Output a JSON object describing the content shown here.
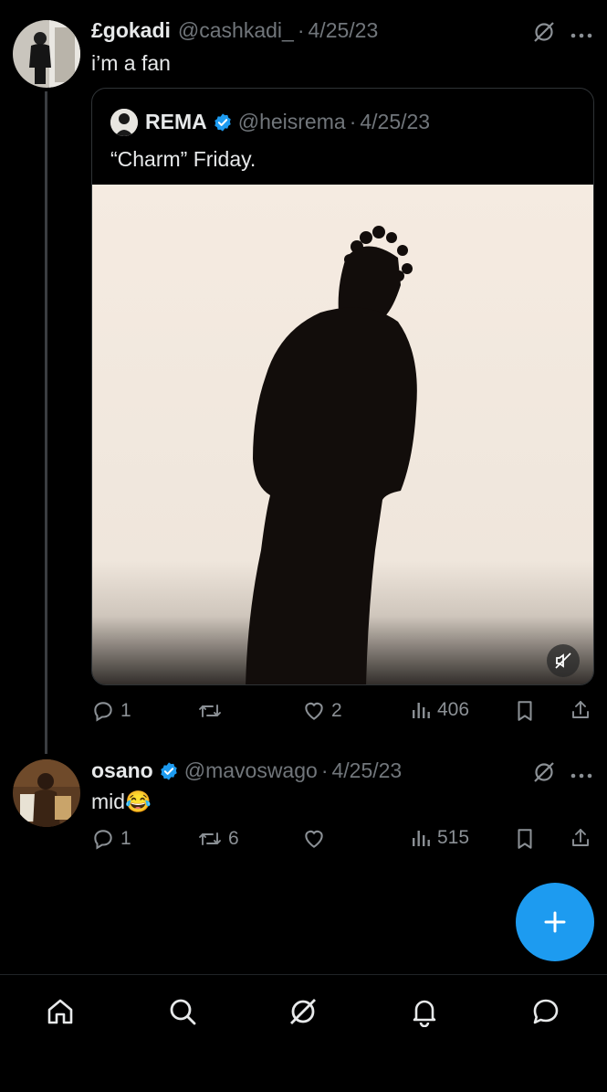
{
  "tweets": [
    {
      "name": "£gokadi",
      "handle": "@cashkadi_",
      "separator": "·",
      "date": "4/25/23",
      "text": "i’m a fan",
      "quote": {
        "name": "REMA",
        "handle": "@heisrema",
        "separator": "·",
        "date": "4/25/23",
        "text": "“Charm” Friday."
      },
      "actions": {
        "replies": "1",
        "retweets": "",
        "likes": "2",
        "views": "406"
      }
    },
    {
      "name": "osano",
      "handle": "@mavoswago",
      "separator": "·",
      "date": "4/25/23",
      "text": "mid",
      "emoji": "😂",
      "actions": {
        "replies": "1",
        "retweets": "6",
        "likes": "",
        "views": "515"
      }
    }
  ],
  "colors": {
    "accent": "#1d9bf0",
    "verified": "#1d9bf0",
    "background": "#000000",
    "secondary_text": "#71767b"
  },
  "icons": {
    "header": [
      "grok-icon",
      "more-icon"
    ],
    "actions": [
      "reply-icon",
      "retweet-icon",
      "like-icon",
      "views-icon",
      "bookmark-icon",
      "share-icon"
    ],
    "nav": [
      "home-icon",
      "search-icon",
      "grok-icon",
      "notifications-icon",
      "messages-icon"
    ],
    "fab": "plus-icon",
    "media": "muted-speaker-icon"
  }
}
